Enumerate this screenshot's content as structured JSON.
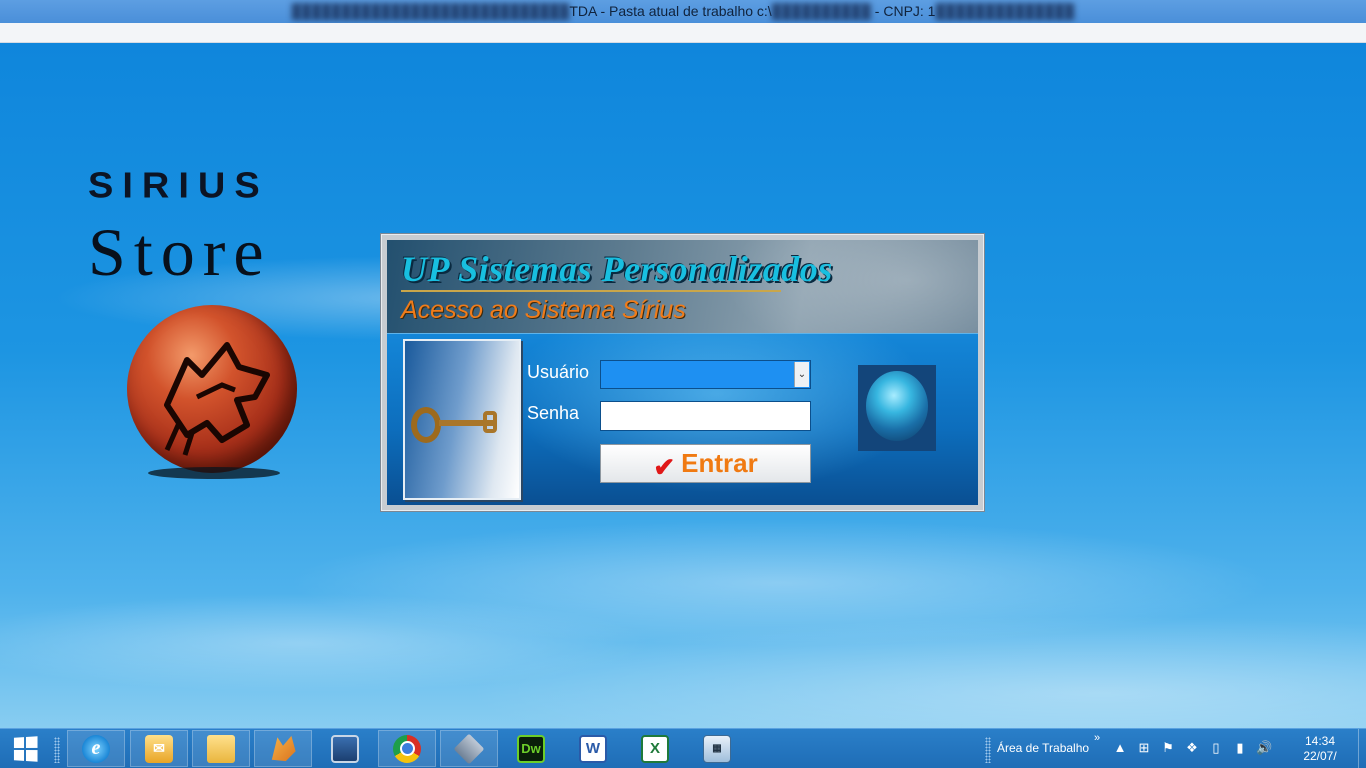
{
  "window": {
    "title_prefix_redacted": "████████████████████████████",
    "title_main": "TDA - Pasta atual de trabalho c:\\",
    "title_path_redacted": "██████████",
    "title_suffix": " - CNPJ: 1",
    "title_cnpj_redacted": "██████████████"
  },
  "brand": {
    "line1": "SIRIUS",
    "line2": "Store"
  },
  "login": {
    "title": "UP Sistemas Personalizados",
    "subtitle": "Acesso ao Sistema Sírius",
    "user_label": "Usuário",
    "user_value": "",
    "password_label": "Senha",
    "password_value": "",
    "submit_label": "Entrar"
  },
  "taskbar": {
    "apps": [
      {
        "name": "internet-explorer",
        "glyph": "e"
      },
      {
        "name": "outlook",
        "glyph": "✉"
      },
      {
        "name": "file-explorer",
        "glyph": ""
      },
      {
        "name": "fox-app",
        "glyph": ""
      },
      {
        "name": "network-connection",
        "glyph": ""
      },
      {
        "name": "chrome",
        "glyph": ""
      },
      {
        "name": "virtualbox",
        "glyph": ""
      },
      {
        "name": "dreamweaver",
        "glyph": "Dw"
      },
      {
        "name": "word",
        "glyph": "W"
      },
      {
        "name": "excel",
        "glyph": "X"
      },
      {
        "name": "calculator",
        "glyph": "▦"
      }
    ],
    "toolbar_label": "Área de Trabalho",
    "toolbar_chevron": "»",
    "tray": {
      "up_arrow": "▲",
      "windows_flag": "⊞",
      "action_flag": "⚑",
      "dropbox": "❖",
      "device": "▯",
      "signal": "▮",
      "volume": "🔊"
    },
    "clock": {
      "time": "14:34",
      "date": "22/07/"
    }
  },
  "colors": {
    "title_text": "#18bfe0",
    "subtitle_text": "#f07c1a",
    "button_text": "#f07a12",
    "taskbar": "#1f6db6"
  }
}
